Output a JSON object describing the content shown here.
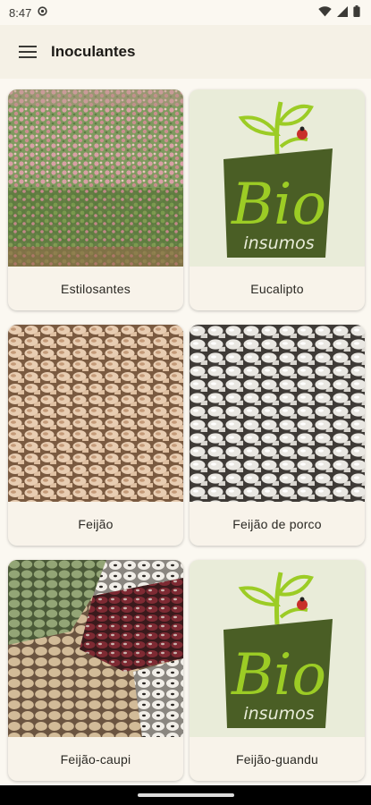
{
  "status_bar": {
    "time": "8:47"
  },
  "app_bar": {
    "title": "Inoculantes"
  },
  "colors": {
    "app_bar_bg": "#f5f1e6",
    "bio_green": "#4a5e25",
    "bio_lime": "#9ccc25"
  },
  "icons": [
    "menu-icon",
    "settings-icon",
    "wifi-icon",
    "signal-icon",
    "battery-icon",
    "bio-insumos-logo"
  ],
  "cards": [
    {
      "label": "Estilosantes",
      "image": "flowering-field"
    },
    {
      "label": "Eucalipto",
      "image": "bio-insumos-logo",
      "logo_word": "Bio",
      "logo_sub": "insumos"
    },
    {
      "label": "Feijão",
      "image": "pinto-beans"
    },
    {
      "label": "Feijão de porco",
      "image": "white-beans"
    },
    {
      "label": "Feijão-caupi",
      "image": "mixed-beans"
    },
    {
      "label": "Feijão-guandu",
      "image": "bio-insumos-logo",
      "logo_word": "Bio",
      "logo_sub": "insumos"
    }
  ]
}
